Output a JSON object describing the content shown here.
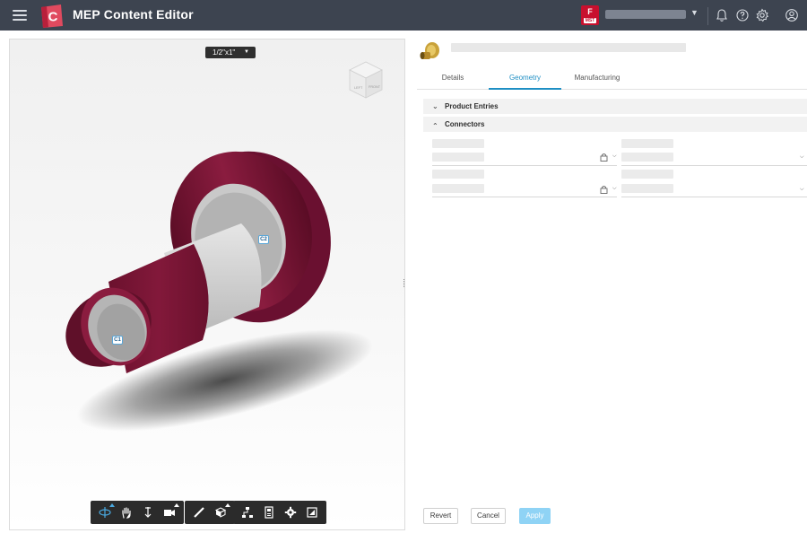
{
  "app": {
    "title": "MEP Content Editor",
    "logo_letter": "C",
    "brand_badge_letter": "F",
    "brand_badge_caption": "MST"
  },
  "header_icons": [
    "bell-icon",
    "help-icon",
    "gear-icon",
    "user-icon"
  ],
  "viewer": {
    "size_selector": "1/2\"x1\"",
    "connector_labels": [
      "C1",
      "C2"
    ],
    "view_cube_faces": [
      "LEFT",
      "FRONT"
    ],
    "toolbar_tools": [
      "orbit-icon",
      "pan-icon",
      "zoom-icon",
      "camera-icon",
      "measure-icon",
      "section-icon",
      "model-tree-icon",
      "properties-icon",
      "settings-icon",
      "fullscreen-icon"
    ]
  },
  "tabs": [
    {
      "label": "Details",
      "active": false
    },
    {
      "label": "Geometry",
      "active": true
    },
    {
      "label": "Manufacturing",
      "active": false
    }
  ],
  "sections": {
    "product_entries": "Product Entries",
    "connectors": "Connectors"
  },
  "buttons": {
    "revert": "Revert",
    "cancel": "Cancel",
    "apply": "Apply"
  },
  "colors": {
    "topbar": "#3d4450",
    "accent": "#1f8fc4",
    "model_maroon": "#7a1535",
    "apply_disabled": "#8fd3f5"
  }
}
